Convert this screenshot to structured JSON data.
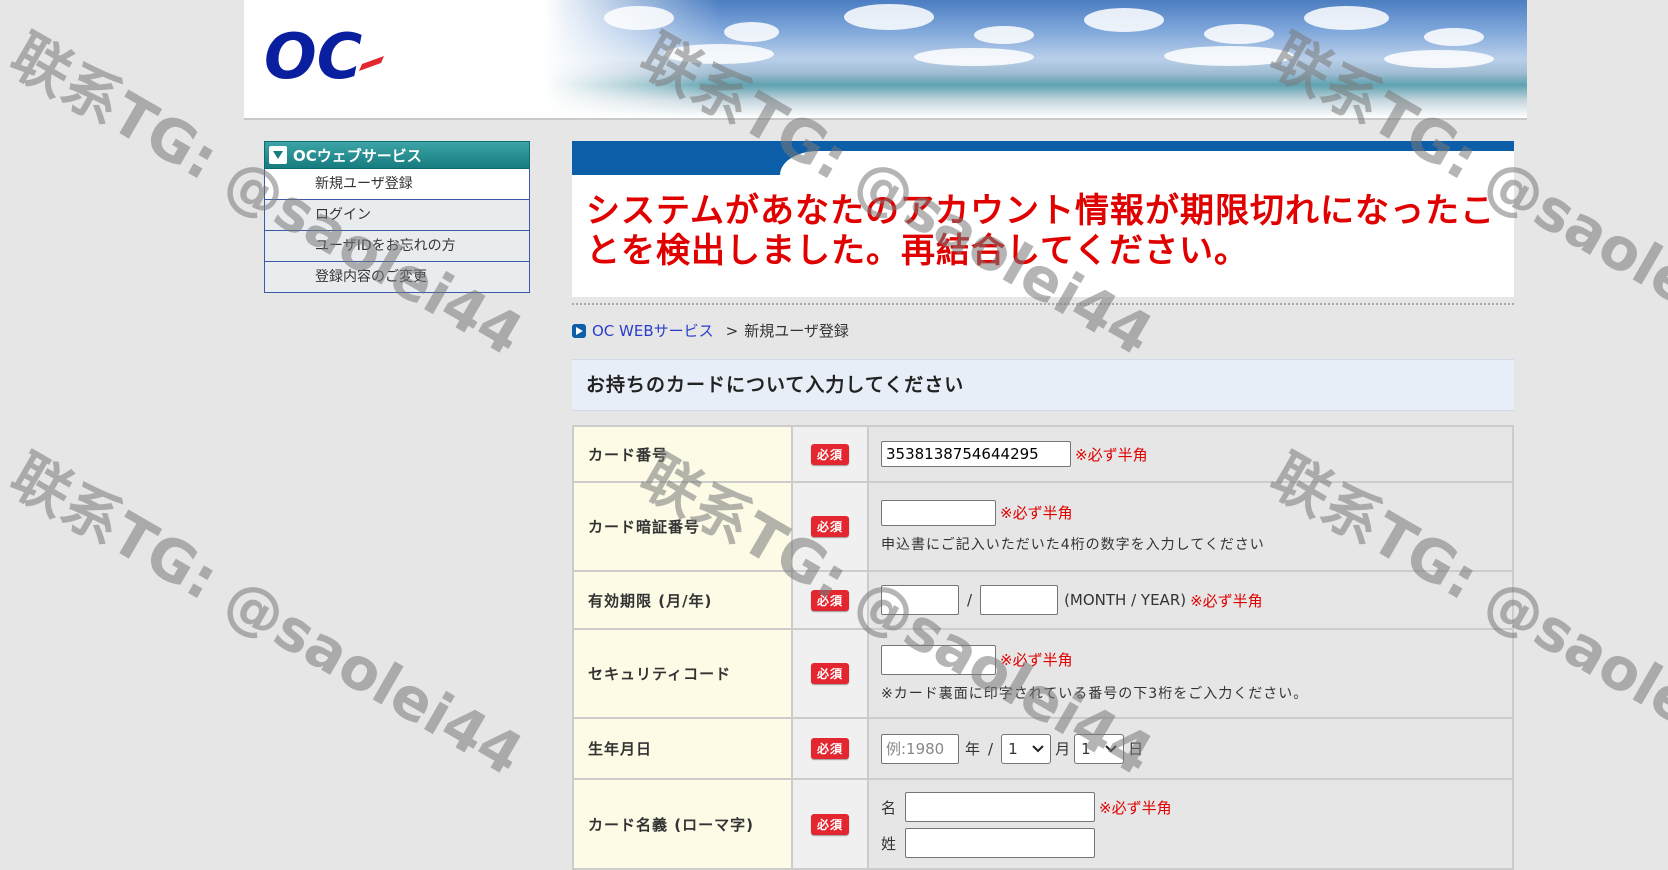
{
  "header": {
    "logo_text": "OC"
  },
  "sidebar": {
    "title": "OCウェブサービス",
    "items": [
      {
        "label": "新規ユーザ登録"
      },
      {
        "label": "ログイン"
      },
      {
        "label": "ユーザIDをお忘れの方"
      },
      {
        "label": "登録内容のご変更"
      }
    ]
  },
  "alert": {
    "line1": "システムがあなたのアカウント情報が期限切れになったこ",
    "line2": "とを検出しました。再結合してください。"
  },
  "breadcrumb": {
    "home": "OC WEBサービス",
    "separator": ">",
    "current": "新規ユーザ登録"
  },
  "section_title": "お持ちのカードについて入力してください",
  "required_badge": "必須",
  "form": {
    "card_number": {
      "label": "カード番号",
      "value": "3538138754644295",
      "hint": "※必ず半角"
    },
    "card_pin": {
      "label": "カード暗証番号",
      "value": "",
      "hint": "※必ず半角",
      "note": "申込書にご記入いただいた4桁の数字を入力してください"
    },
    "expiry": {
      "label": "有効期限 (月/年)",
      "month": "",
      "year": "",
      "slash": "/",
      "format": "(MONTH / YEAR)",
      "hint": "※必ず半角"
    },
    "security_code": {
      "label": "セキュリティコード",
      "value": "",
      "hint": "※必ず半角",
      "note": "※カード裏面に印字されている番号の下3桁をご入力ください。"
    },
    "birthdate": {
      "label": "生年月日",
      "year_placeholder": "例:1980",
      "year_unit": "年",
      "slash": "/",
      "month_value": "1",
      "month_unit": "月",
      "day_value": "1",
      "day_unit": "日"
    },
    "card_name": {
      "label": "カード名義 (ローマ字)",
      "first_label": "名",
      "last_label": "姓",
      "hint": "※必ず半角",
      "first_value": "",
      "last_value": ""
    }
  },
  "watermark": "联系TG: @saolei44",
  "colors": {
    "alert": "#e00000",
    "primary_blue": "#0d5ea9",
    "sidebar_teal": "#167c80",
    "badge_red": "#e3262f"
  }
}
